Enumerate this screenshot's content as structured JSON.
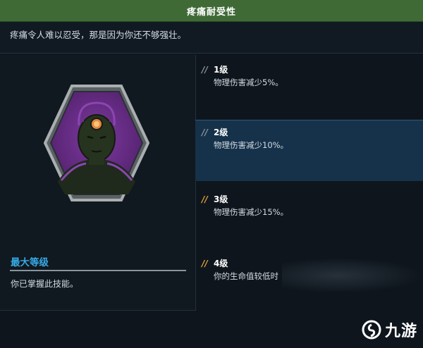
{
  "header": {
    "title": "疼痛耐受性"
  },
  "skill": {
    "description": "疼痛令人难以忍受，那是因为你还不够强壮。"
  },
  "badge": {
    "icon": "head-silhouette-icon",
    "border_color": "#8f9497",
    "fill_color": "#6a2f86"
  },
  "max_level": {
    "title": "最大等级",
    "text": "你已掌握此技能。"
  },
  "levels": [
    {
      "marker": "//",
      "name": "1级",
      "effect": "物理伤害减少5%。",
      "marker_color": "#8b949c"
    },
    {
      "marker": "//",
      "name": "2级",
      "effect": "物理伤害减少10%。",
      "marker_color": "#8b949c"
    },
    {
      "marker": "//",
      "name": "3级",
      "effect": "物理伤害减少15%。",
      "marker_color": "#e0a53a"
    },
    {
      "marker": "//",
      "name": "4级",
      "effect": "你的生命值较低时",
      "marker_color": "#e0a53a"
    }
  ],
  "watermark": {
    "text": "九游",
    "icon": "jiuyou-logo-icon"
  },
  "colors": {
    "title_bar": "#3f6a35",
    "active_level": "#16324a",
    "accent": "#37a9e6"
  }
}
